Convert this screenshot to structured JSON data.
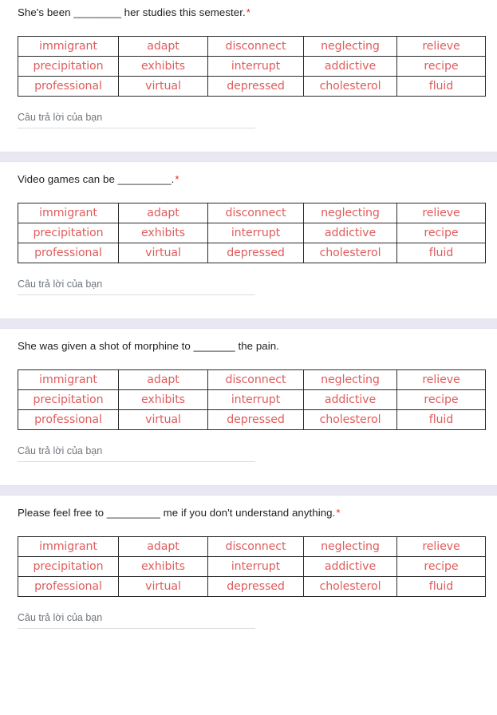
{
  "wordbank": {
    "rows": [
      [
        "immigrant",
        "adapt",
        "disconnect",
        "neglecting",
        "relieve"
      ],
      [
        "precipitation",
        "exhibits",
        "interrupt",
        "addictive",
        "recipe"
      ],
      [
        "professional",
        "virtual",
        "depressed",
        "cholesterol",
        "fluid"
      ]
    ]
  },
  "answer_placeholder": "Câu trả lời của bạn",
  "required_marker": "*",
  "colors": {
    "word_red": "#e05c5c",
    "required_red": "#d93025",
    "gap_band": "#e9e8f2",
    "table_border": "#2b2b2b",
    "question_text": "#202124",
    "placeholder": "#70757a"
  },
  "questions": [
    {
      "id": "q1",
      "text": "She's been ________ her studies this semester.",
      "required": true,
      "answer_value": ""
    },
    {
      "id": "q2",
      "text": "Video games can be _________.",
      "required": true,
      "answer_value": ""
    },
    {
      "id": "q3",
      "text": "She was given a shot of morphine to _______ the pain.",
      "required": false,
      "answer_value": ""
    },
    {
      "id": "q4",
      "text": "Please feel free to _________ me if you don't understand anything.",
      "required": true,
      "answer_value": ""
    }
  ]
}
